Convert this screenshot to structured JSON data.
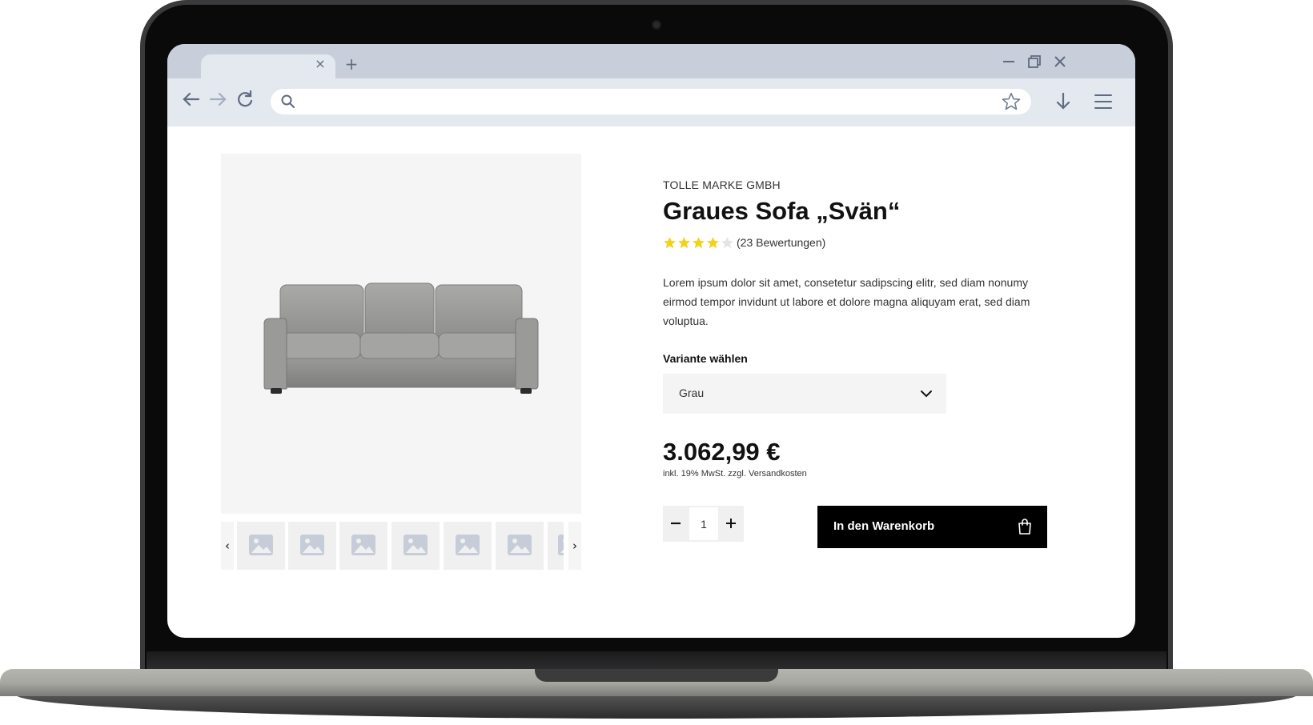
{
  "browser": {
    "tab_close_glyph": "×",
    "new_tab_glyph": "+",
    "url_value": "",
    "icons": [
      "back-icon",
      "forward-icon",
      "reload-icon",
      "search-icon",
      "star-icon",
      "download-icon",
      "menu-icon",
      "minimize-icon",
      "restore-icon",
      "close-icon"
    ]
  },
  "product": {
    "brand": "TOLLE MARKE GMBH",
    "title": "Graues Sofa „Svän“",
    "rating": 4,
    "rating_max": 5,
    "rating_count": "(23 Bewertungen)",
    "description": "Lorem ipsum dolor sit amet, consetetur sadipscing elitr, sed diam nonumy eirmod tempor invidunt ut labore et dolore magna aliquyam erat, sed diam voluptua.",
    "variant_label": "Variante wählen",
    "variant_value": "Grau",
    "price": "3.062,99 €",
    "tax_note": "inkl. 19% MwSt. zzgl. Versandkosten",
    "quantity": "1",
    "cart_button": "In den Warenkorb"
  },
  "gallery": {
    "prev_glyph": "‹",
    "next_glyph": "›",
    "thumbnail_count": 7
  },
  "colors": {
    "star_filled": "#f2d21a",
    "star_empty": "#e5e5e5",
    "button_bg": "#000000",
    "tabbar_bg": "#c8ceda",
    "toolbar_bg": "#e4e8ef"
  }
}
